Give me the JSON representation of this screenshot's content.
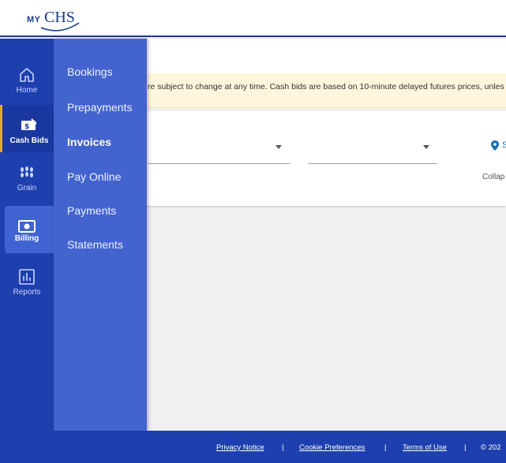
{
  "brand": {
    "prefix": "MY",
    "name": "CHS"
  },
  "notice": {
    "text": "re subject to change at any time. Cash bids are based on 10-minute delayed futures prices, unles"
  },
  "filters": {
    "location_partial": "S",
    "collapse_partial": "Collap"
  },
  "rail": {
    "items": [
      {
        "label": "Home",
        "icon": "home-icon"
      },
      {
        "label": "Cash Bids",
        "icon": "cash-icon"
      },
      {
        "label": "Grain",
        "icon": "grain-icon"
      },
      {
        "label": "Billing",
        "icon": "billing-icon"
      },
      {
        "label": "Reports",
        "icon": "reports-icon"
      }
    ]
  },
  "billing_menu": {
    "items": [
      {
        "label": "Bookings"
      },
      {
        "label": "Prepayments"
      },
      {
        "label": "Invoices"
      },
      {
        "label": "Pay Online"
      },
      {
        "label": "Payments"
      },
      {
        "label": "Statements"
      }
    ]
  },
  "footer": {
    "privacy": "Privacy Notice",
    "cookies": "Cookie Preferences",
    "terms": "Terms of Use",
    "separator": "|",
    "copyright_partial": "© 202"
  },
  "colors": {
    "rail": "#1e3fae",
    "flyout": "#4364cf",
    "accent": "#e6a823",
    "notice_bg": "#fdf6dc"
  }
}
